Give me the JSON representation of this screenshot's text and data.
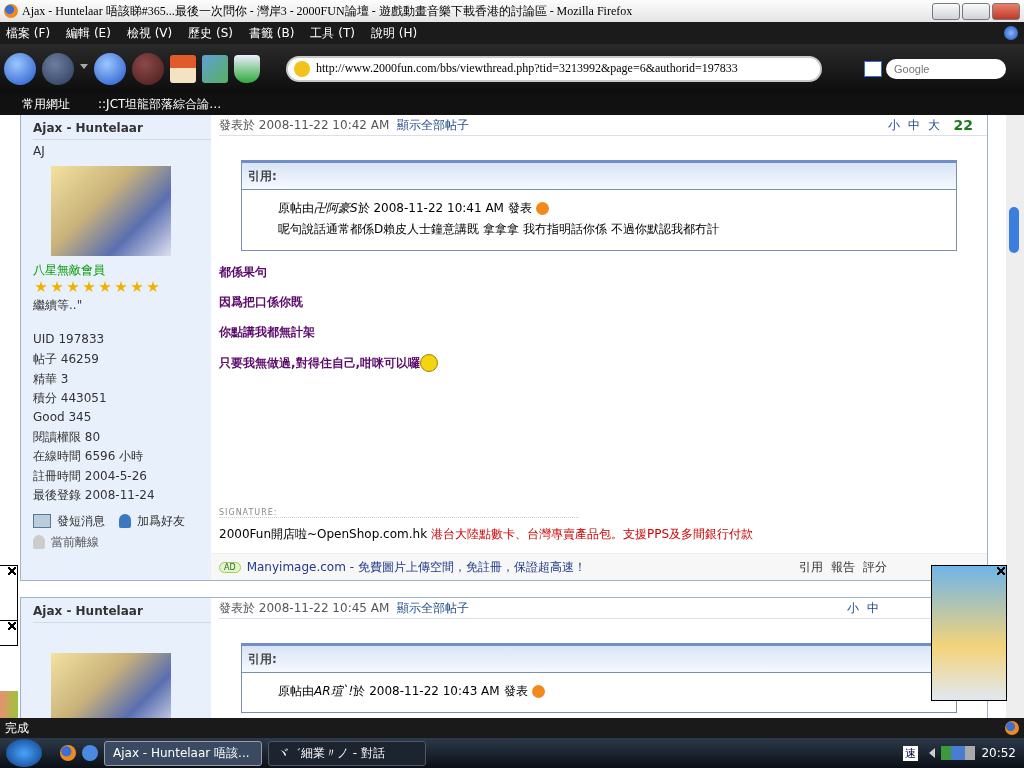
{
  "window": {
    "title": "Ajax - Huntelaar 唔該睇#365...最後一次問你 - 灣岸3 - 2000FUN論壇 - 遊戲動畫音樂下載香港的討論區 - Mozilla Firefox"
  },
  "menu": [
    "檔案 (F)",
    "編輯 (E)",
    "檢視 (V)",
    "歷史 (S)",
    "書籤 (B)",
    "工具 (T)",
    "說明 (H)"
  ],
  "toolbar": {
    "url": "http://www.2000fun.com/bbs/viewthread.php?tid=3213992&page=6&authorid=197833",
    "search_placeholder": "Google"
  },
  "bookmarks": [
    "常用網址",
    "::JCT坦龍部落綜合論…"
  ],
  "posts": [
    {
      "author": "Ajax - Huntelaar",
      "custom_title": "AJ",
      "rank": "八星無敵會員",
      "stars": 8,
      "bio": "繼續等..\"",
      "stats": [
        {
          "label": "UID",
          "value": "197833"
        },
        {
          "label": "帖子",
          "value": "46259"
        },
        {
          "label": "精華",
          "value": "3"
        },
        {
          "label": "積分",
          "value": "443051"
        },
        {
          "label": "Good",
          "value": "345"
        },
        {
          "label": "閱讀權限",
          "value": "80"
        },
        {
          "label": "在線時間",
          "value": "6596 小時"
        },
        {
          "label": "註冊時間",
          "value": "2004-5-26"
        },
        {
          "label": "最後登錄",
          "value": "2008-11-24"
        }
      ],
      "actions": [
        "發短消息",
        "加爲好友"
      ],
      "status": "當前離線",
      "posted": "發表於 2008-11-22 10:42 AM",
      "show_all": "顯示全部帖子",
      "font_sizes": [
        "小",
        "中",
        "大"
      ],
      "floor": "22",
      "quote": {
        "title": "引用:",
        "by_prefix": "原帖由",
        "by_user": "卍阿豪S",
        "by_suffix": "於 2008-11-22 10:41 AM 發表",
        "text": "呢句說話通常都係D賴皮人士鐘意講既 拿拿拿 我冇指明話你係 不過你默認我都冇計"
      },
      "lines": [
        "都係果句",
        "因爲把口係你既",
        "你點講我都無計架",
        "只要我無做過,對得住自己,咁咪可以囉"
      ],
      "signature_label": "SIGNATURE:",
      "signature": {
        "plain": "2000Fun開店啦~OpenShop.com.hk",
        "highlight": "港台大陸點數卡、台灣專賣產品包。支援PPS及多間銀行付款"
      },
      "ad": {
        "badge": "AD",
        "text": "Manyimage.com - 免費圖片上傳空間，免註冊，保證超高速！"
      },
      "post_actions": [
        "引用",
        "報告",
        "評分"
      ]
    },
    {
      "author": "Ajax - Huntelaar",
      "posted": "發表於 2008-11-22 10:45 AM",
      "show_all": "顯示全部帖子",
      "font_sizes": [
        "小",
        "中"
      ],
      "quote": {
        "title": "引用:",
        "by_prefix": "原帖由",
        "by_user": "AR瑄`!",
        "by_suffix": "於 2008-11-22 10:43 AM 發表"
      }
    }
  ],
  "status_bar": "完成",
  "taskbar": {
    "tasks": [
      {
        "label": "Ajax - Huntelaar 唔該...",
        "selected": true
      },
      {
        "label": "ヾ゛細業〃ノ - 對話",
        "selected": false
      }
    ],
    "tray_text": "速",
    "time": "20:52"
  }
}
